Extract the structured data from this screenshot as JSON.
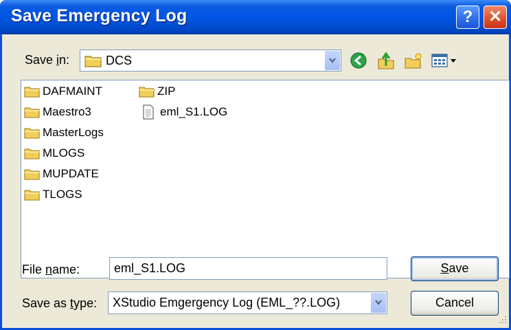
{
  "dialog": {
    "title": "Save Emergency Log",
    "help_label": "?",
    "close_label": "✕"
  },
  "save_in": {
    "label_prefix": "Save ",
    "label_accel": "i",
    "label_suffix": "n:",
    "folder": "DCS"
  },
  "toolbar": {
    "back_icon": "back-arrow-icon",
    "up_icon": "up-folder-icon",
    "new_folder_icon": "new-folder-icon",
    "views_icon": "views-menu-icon"
  },
  "files": {
    "col1": [
      "DAFMAINT",
      "Maestro3",
      "MasterLogs",
      "MLOGS",
      "MUPDATE",
      "TLOGS"
    ],
    "col2_folder": "ZIP",
    "col2_file": "eml_S1.LOG"
  },
  "file_name": {
    "label_prefix": "File ",
    "label_accel": "n",
    "label_suffix": "ame:",
    "value": "eml_S1.LOG"
  },
  "save_type": {
    "label_prefix": "Save as ",
    "label_accel": "t",
    "label_suffix": "ype:",
    "value": "XStudio Emgergency Log (EML_??.LOG)"
  },
  "buttons": {
    "save_accel": "S",
    "save_rest": "ave",
    "cancel": "Cancel"
  },
  "colors": {
    "title_bar": "#0055e5",
    "dialog_bg": "#ece9d8",
    "folder_icon": "#f2cf5b"
  }
}
